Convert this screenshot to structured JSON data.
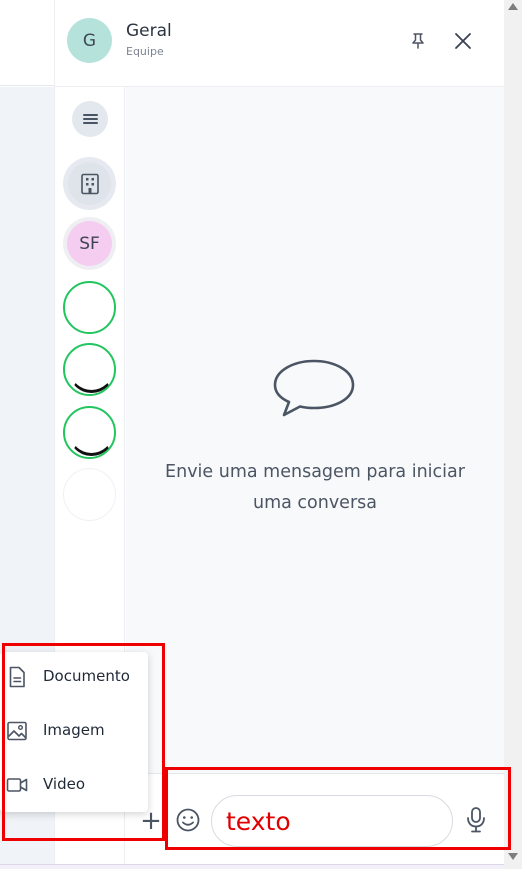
{
  "header": {
    "avatar_initial": "G",
    "title": "Geral",
    "subtitle": "Equipe",
    "pin_icon": "pin-icon",
    "close_icon": "close-icon"
  },
  "sidebar": {
    "menu_icon": "hamburger-menu-icon",
    "items": [
      {
        "kind": "icon",
        "icon": "building-icon"
      },
      {
        "kind": "initials",
        "label": "SF",
        "color": "#f5cdf0"
      },
      {
        "kind": "avatar",
        "status_color": "#22c55e"
      },
      {
        "kind": "avatar",
        "status_color": "#22c55e"
      },
      {
        "kind": "avatar",
        "status_color": "#22c55e"
      },
      {
        "kind": "avatar"
      }
    ]
  },
  "chat": {
    "empty_icon": "chat-bubble-icon",
    "empty_text_line1": "Envie uma mensagem para iniciar",
    "empty_text_line2": "uma conversa"
  },
  "attach_menu": {
    "items": [
      {
        "label": "Documento",
        "icon": "document-icon"
      },
      {
        "label": "Imagem",
        "icon": "image-icon"
      },
      {
        "label": "Video",
        "icon": "video-icon"
      }
    ]
  },
  "composer": {
    "plus_label": "+",
    "emoji_icon": "smiley-icon",
    "input_value": "texto",
    "mic_icon": "microphone-icon"
  },
  "colors": {
    "online": "#22c55e",
    "annotation": "#ee0000",
    "input_text": "#e00000"
  }
}
